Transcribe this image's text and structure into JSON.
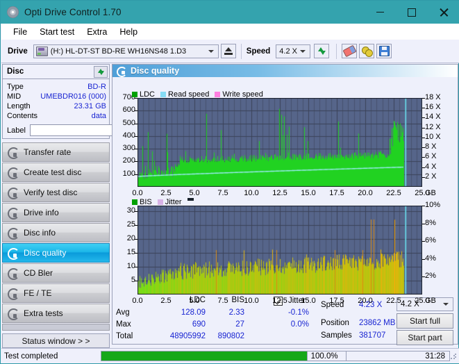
{
  "window": {
    "title": "Opti Drive Control 1.70",
    "icon": "disc-icon",
    "minimize": "—",
    "maximize": "☐",
    "close": "✕"
  },
  "menu": {
    "items": [
      "File",
      "Start test",
      "Extra",
      "Help"
    ]
  },
  "toolbar": {
    "drive_label": "Drive",
    "drive_value": "(H:)  HL-DT-ST BD-RE  WH16NS48 1.D3",
    "eject_icon": "eject-icon",
    "speed_label": "Speed",
    "speed_value": "4.2 X",
    "refresh_icon": "refresh-icon",
    "erase_icon": "eraser-icon",
    "tools_icon": "gears-icon",
    "save_icon": "save-icon"
  },
  "disc_panel": {
    "title": "Disc",
    "refresh_icon": "refresh-icon",
    "rows": [
      {
        "key": "Type",
        "value": "BD-R"
      },
      {
        "key": "MID",
        "value": "UMEBDR016 (000)"
      },
      {
        "key": "Length",
        "value": "23.31 GB"
      },
      {
        "key": "Contents",
        "value": "data"
      }
    ],
    "label_key": "Label",
    "label_value": "",
    "label_placeholder": "",
    "disc_icon": "cd-icon"
  },
  "nav": {
    "items": [
      {
        "label": "Transfer rate",
        "selected": false
      },
      {
        "label": "Create test disc",
        "selected": false
      },
      {
        "label": "Verify test disc",
        "selected": false
      },
      {
        "label": "Drive info",
        "selected": false
      },
      {
        "label": "Disc info",
        "selected": false
      },
      {
        "label": "Disc quality",
        "selected": true
      },
      {
        "label": "CD Bler",
        "selected": false
      },
      {
        "label": "FE / TE",
        "selected": false
      },
      {
        "label": "Extra tests",
        "selected": false
      }
    ],
    "status_button": "Status window > >"
  },
  "content": {
    "header_title": "Disc quality",
    "header_icon": "disc-quality-icon"
  },
  "chart_data": [
    {
      "type": "area",
      "name": "ldc-chart",
      "title": "",
      "xlabel": "GB",
      "ylabel": "",
      "xlim": [
        0,
        25
      ],
      "ylim": [
        0,
        700
      ],
      "y2lim": [
        0,
        18
      ],
      "y2label": "X",
      "xticks": [
        "0.0",
        "2.5",
        "5.0",
        "7.5",
        "10.0",
        "12.5",
        "15.0",
        "17.5",
        "20.0",
        "22.5",
        "25.0"
      ],
      "xtick_values": [
        0,
        2.5,
        5,
        7.5,
        10,
        12.5,
        15,
        17.5,
        20,
        22.5,
        25
      ],
      "yticks": [
        "100",
        "200",
        "300",
        "400",
        "500",
        "600",
        "700"
      ],
      "ytick_values": [
        100,
        200,
        300,
        400,
        500,
        600,
        700
      ],
      "y2ticks": [
        "2 X",
        "4 X",
        "6 X",
        "8 X",
        "10 X",
        "12 X",
        "14 X",
        "16 X",
        "18 X"
      ],
      "y2tick_values": [
        2,
        4,
        6,
        8,
        10,
        12,
        14,
        16,
        18
      ],
      "x_unit": "GB",
      "grid": true,
      "legend_position": "top-left",
      "legend": [
        {
          "label": "LDC",
          "color": "#00a000"
        },
        {
          "label": "Read speed",
          "color": "#86dcf4"
        },
        {
          "label": "Write speed",
          "color": "#ff7fe0"
        }
      ],
      "data_end_x": 23.4,
      "series": [
        {
          "name": "LDC",
          "color": "#21d221",
          "kind": "area"
        },
        {
          "name": "Read speed",
          "color": "#9cecf7",
          "kind": "line"
        }
      ]
    },
    {
      "type": "area",
      "name": "bis-chart",
      "title": "",
      "xlabel": "GB",
      "ylabel": "",
      "xlim": [
        0,
        25
      ],
      "ylim": [
        0,
        32
      ],
      "y2lim": [
        0,
        10
      ],
      "y2label": "%",
      "xticks": [
        "0.0",
        "2.5",
        "5.0",
        "7.5",
        "10.0",
        "12.5",
        "15.0",
        "17.5",
        "20.0",
        "22.5",
        "25.0"
      ],
      "xtick_values": [
        0,
        2.5,
        5,
        7.5,
        10,
        12.5,
        15,
        17.5,
        20,
        22.5,
        25
      ],
      "yticks": [
        "5",
        "10",
        "15",
        "20",
        "25",
        "30"
      ],
      "ytick_values": [
        5,
        10,
        15,
        20,
        25,
        30
      ],
      "y2ticks": [
        "2%",
        "4%",
        "6%",
        "8%",
        "10%"
      ],
      "y2tick_values": [
        2,
        4,
        6,
        8,
        10
      ],
      "x_unit": "GB",
      "grid": true,
      "legend_position": "top-left",
      "legend": [
        {
          "label": "BIS",
          "color": "#00a000"
        },
        {
          "label": "Jitter",
          "color": "#d7b2e6"
        }
      ],
      "data_end_x": 23.4,
      "series": [
        {
          "name": "BIS",
          "color": "#6ee018",
          "kind": "area"
        },
        {
          "name": "Jitter",
          "color": "#d7b2e6",
          "kind": "line"
        }
      ]
    }
  ],
  "stats": {
    "col_headers": [
      "LDC",
      "BIS"
    ],
    "row_labels": [
      "Avg",
      "Max",
      "Total"
    ],
    "ldc": {
      "avg": "128.09",
      "max": "690",
      "total": "48905992"
    },
    "bis": {
      "avg": "2.33",
      "max": "27",
      "total": "890802"
    },
    "jitter": {
      "label": "Jitter",
      "checked": true,
      "avg": "-0.1%",
      "max": "0.0%"
    },
    "speed_label": "Speed",
    "speed_value": "4.23 X",
    "position_label": "Position",
    "position_value": "23862 MB",
    "samples_label": "Samples",
    "samples_value": "381707",
    "speed_select": "4.2 X",
    "start_full": "Start full",
    "start_part": "Start part"
  },
  "statusbar": {
    "message": "Test completed",
    "progress_percent": 100,
    "percent_text": "100.0%",
    "elapsed": "31:28"
  }
}
